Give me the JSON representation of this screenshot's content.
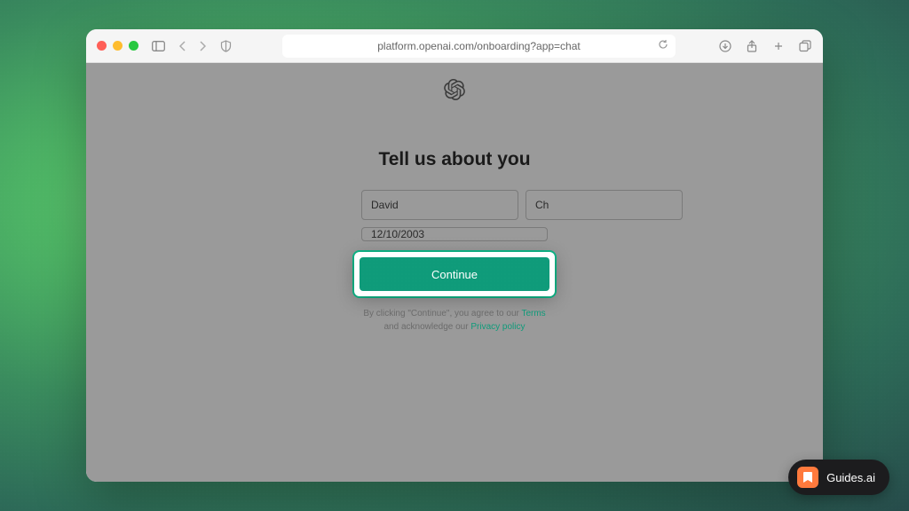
{
  "browser": {
    "url": "platform.openai.com/onboarding?app=chat"
  },
  "page": {
    "heading": "Tell us about you",
    "firstName": "David",
    "lastName": "Ch",
    "birthdate": "12/10/2003",
    "continueLabel": "Continue",
    "disclaimer": {
      "prefix": "By clicking \"Continue\", you agree to our ",
      "termsLabel": "Terms",
      "mid": " and acknowledge our ",
      "privacyLabel": "Privacy policy"
    }
  },
  "badge": {
    "label": "Guides.ai"
  }
}
